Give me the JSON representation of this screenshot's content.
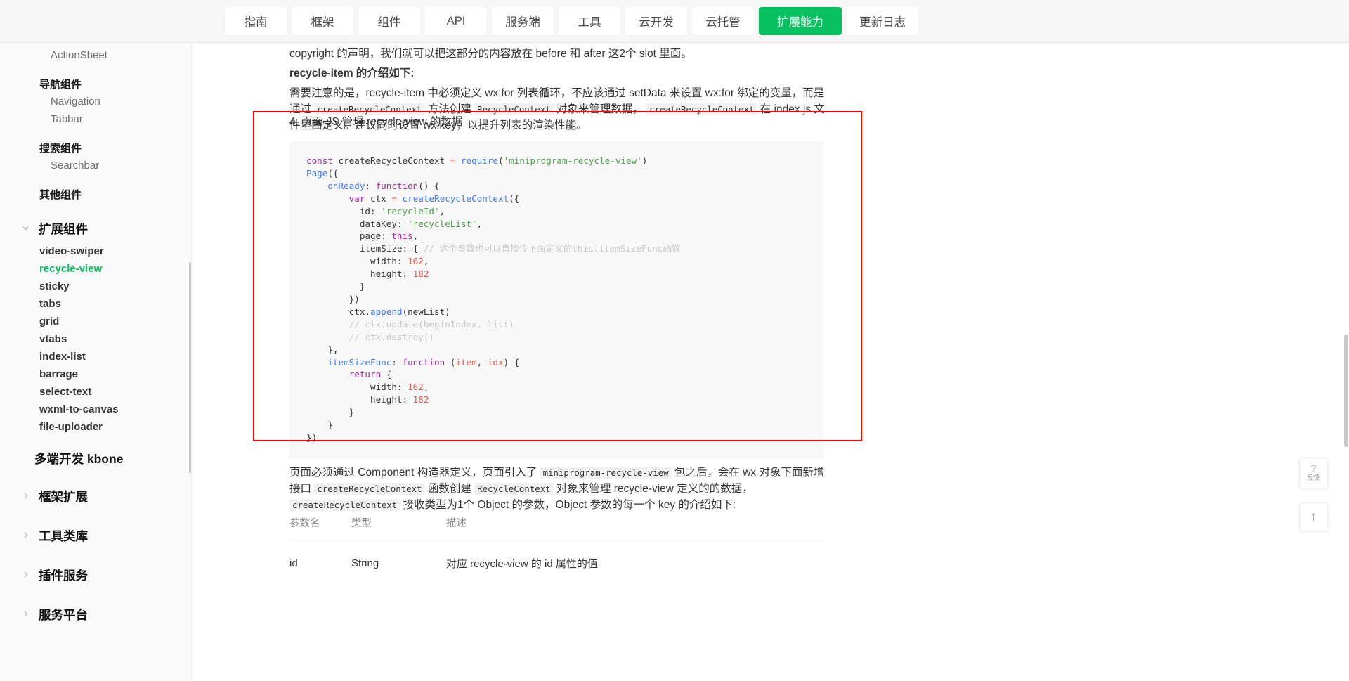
{
  "topnav": {
    "items": [
      {
        "label": "指南",
        "active": false
      },
      {
        "label": "框架",
        "active": false
      },
      {
        "label": "组件",
        "active": false
      },
      {
        "label": "API",
        "active": false
      },
      {
        "label": "服务端",
        "active": false
      },
      {
        "label": "工具",
        "active": false
      },
      {
        "label": "云开发",
        "active": false
      },
      {
        "label": "云托管",
        "active": false
      },
      {
        "label": "扩展能力",
        "active": true
      },
      {
        "label": "更新日志",
        "active": false
      }
    ]
  },
  "sidebar": {
    "items": [
      {
        "label": "ActionSheet",
        "type": "leaf"
      },
      {
        "label": "导航组件",
        "type": "group"
      },
      {
        "label": "Navigation",
        "type": "leaf"
      },
      {
        "label": "Tabbar",
        "type": "leaf"
      },
      {
        "label": "搜索组件",
        "type": "group"
      },
      {
        "label": "Searchbar",
        "type": "leaf"
      },
      {
        "label": "其他组件",
        "type": "group"
      },
      {
        "label": "扩展组件",
        "type": "top-expanded",
        "icon": "chevron-down-icon"
      },
      {
        "label": "video-swiper",
        "type": "bold-leaf"
      },
      {
        "label": "recycle-view",
        "type": "bold-leaf",
        "current": true
      },
      {
        "label": "sticky",
        "type": "bold-leaf"
      },
      {
        "label": "tabs",
        "type": "bold-leaf"
      },
      {
        "label": "grid",
        "type": "bold-leaf"
      },
      {
        "label": "vtabs",
        "type": "bold-leaf"
      },
      {
        "label": "index-list",
        "type": "bold-leaf"
      },
      {
        "label": "barrage",
        "type": "bold-leaf"
      },
      {
        "label": "select-text",
        "type": "bold-leaf"
      },
      {
        "label": "wxml-to-canvas",
        "type": "bold-leaf"
      },
      {
        "label": "file-uploader",
        "type": "bold-leaf"
      },
      {
        "label": "多端开发 kbone",
        "type": "plain-top"
      },
      {
        "label": "框架扩展",
        "type": "top-collapsed",
        "icon": "chevron-right-icon"
      },
      {
        "label": "工具类库",
        "type": "top-collapsed",
        "icon": "chevron-right-icon"
      },
      {
        "label": "插件服务",
        "type": "top-collapsed",
        "icon": "chevron-right-icon"
      },
      {
        "label": "服务平台",
        "type": "top-collapsed",
        "icon": "chevron-right-icon"
      }
    ]
  },
  "content": {
    "para1": "copyright 的声明，我们就可以把这部分的内容放在 before 和 after 这2个 slot 里面。",
    "para2_bold": "recycle-item",
    "para2_rest": " 的介绍如下:",
    "para3": {
      "a": "需要注意的是，recycle-item 中必须定义 wx:for 列表循环，不应该通过 setData 来设置 wx:for 绑定的变量，而是通过 ",
      "code1": "createRecycleContext",
      "b": " 方法创建 ",
      "code2": "RecycleContext",
      "c": " 对象来管理数据， ",
      "code3": "createRecycleContext",
      "d": " 在 index.js 文件里面定义。建议同时设置 wx:key，以提升列表的渲染性能。"
    },
    "list_item": "4. 页面 JS 管理 recycle-view 的数据",
    "code_lines": [
      "const createRecycleContext = require('miniprogram-recycle-view')",
      "Page({",
      "    onReady: function() {",
      "        var ctx = createRecycleContext({",
      "          id: 'recycleId',",
      "          dataKey: 'recycleList',",
      "          page: this,",
      "          itemSize: { // 这个参数也可以直接传下面定义的this.itemSizeFunc函数",
      "            width: 162,",
      "            height: 182",
      "          }",
      "        })",
      "        ctx.append(newList)",
      "        // ctx.update(beginIndex, list)",
      "        // ctx.destroy()",
      "    },",
      "    itemSizeFunc: function (item, idx) {",
      "        return {",
      "            width: 162,",
      "            height: 182",
      "        }",
      "    }",
      "})"
    ],
    "para4": {
      "a": "页面必须通过 Component 构造器定义，页面引入了 ",
      "code1": "miniprogram-recycle-view",
      "b": " 包之后，会在 wx 对象下面新增接口 ",
      "code2": "createRecycleContext",
      "c": " 函数创建 ",
      "code3": "RecycleContext",
      "d": " 对象来管理 recycle-view 定义的的数据， ",
      "code4": "createRecycleContext",
      "e": " 接收类型为1个 Object 的参数，Object 参数的每一个 key 的介绍如下:"
    },
    "table": {
      "headers": [
        "参数名",
        "类型",
        "描述"
      ],
      "rows": [
        [
          "id",
          "String",
          "对应 recycle-view 的 id 属性的值"
        ]
      ]
    }
  },
  "floating": {
    "help_icon": "question-mark-icon",
    "help_label": "反馈",
    "scroll_top_icon": "arrow-up-icon"
  },
  "colors": {
    "accent_green": "#07c160",
    "highlight_red": "#ff0000",
    "nav_bg": "#f7f7f7",
    "sidebar_bg": "#fafafa",
    "code_bg": "#f8f8f8"
  }
}
